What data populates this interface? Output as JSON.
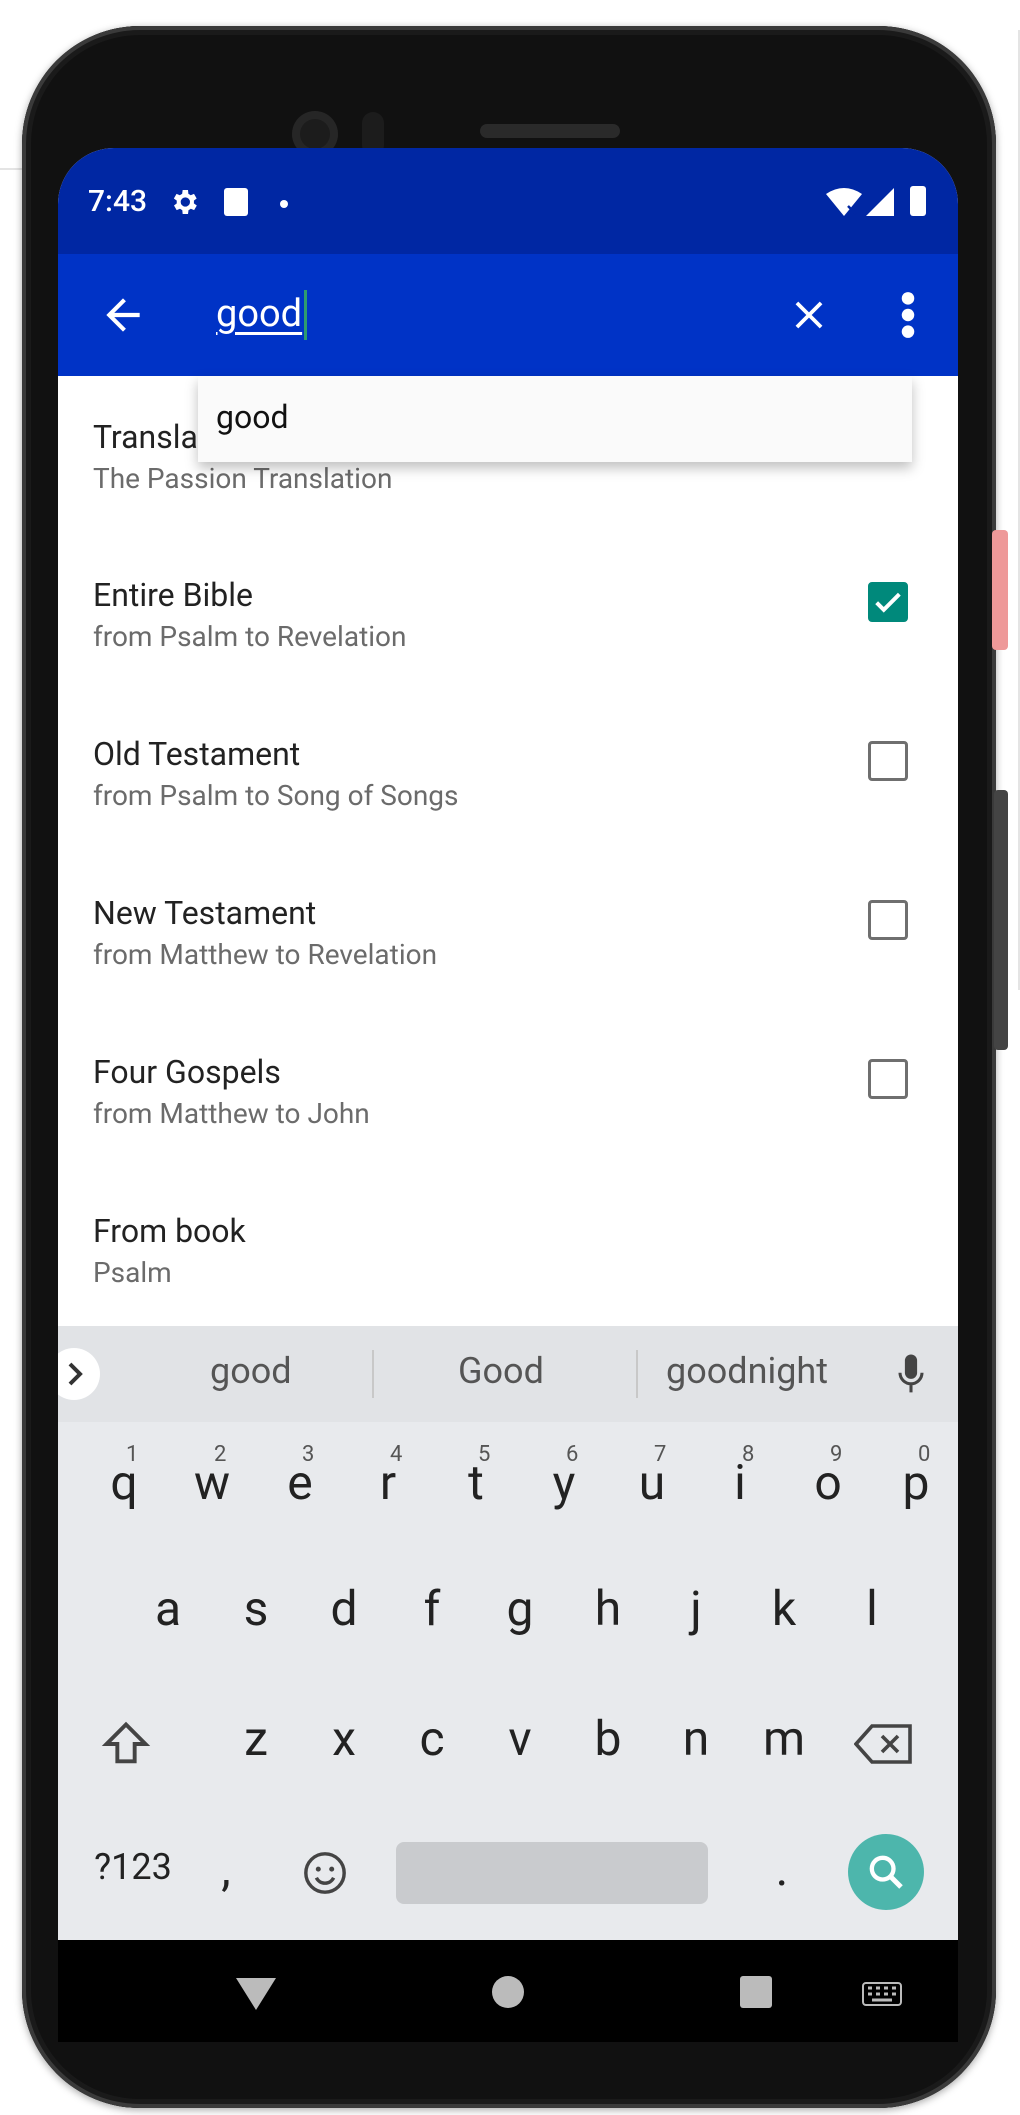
{
  "status_bar": {
    "time": "7:43"
  },
  "search": {
    "query": "good",
    "autocomplete": "good"
  },
  "options": [
    {
      "title": "Translation",
      "subtitle": "The Passion Translation"
    },
    {
      "title": "Entire Bible",
      "subtitle": "from Psalm to Revelation",
      "checked": true
    },
    {
      "title": "Old Testament",
      "subtitle": "from Psalm to Song of Songs",
      "checked": false
    },
    {
      "title": "New Testament",
      "subtitle": "from Matthew to Revelation",
      "checked": false
    },
    {
      "title": "Four Gospels",
      "subtitle": "from Matthew to John",
      "checked": false
    },
    {
      "title": "From book",
      "subtitle": "Psalm"
    }
  ],
  "keyboard": {
    "suggestions": [
      "good",
      "Good",
      "goodnight"
    ],
    "row1": [
      "q",
      "w",
      "e",
      "r",
      "t",
      "y",
      "u",
      "i",
      "o",
      "p"
    ],
    "row1_hints": [
      "1",
      "2",
      "3",
      "4",
      "5",
      "6",
      "7",
      "8",
      "9",
      "0"
    ],
    "row2": [
      "a",
      "s",
      "d",
      "f",
      "g",
      "h",
      "j",
      "k",
      "l"
    ],
    "row3": [
      "z",
      "x",
      "c",
      "v",
      "b",
      "n",
      "m"
    ],
    "symbols_key": "?123",
    "comma": ",",
    "period": "."
  },
  "colors": {
    "status_bar": "#0027a3",
    "app_bar": "#0033c6",
    "accent": "#00897b",
    "search_key": "#4db6ac"
  }
}
